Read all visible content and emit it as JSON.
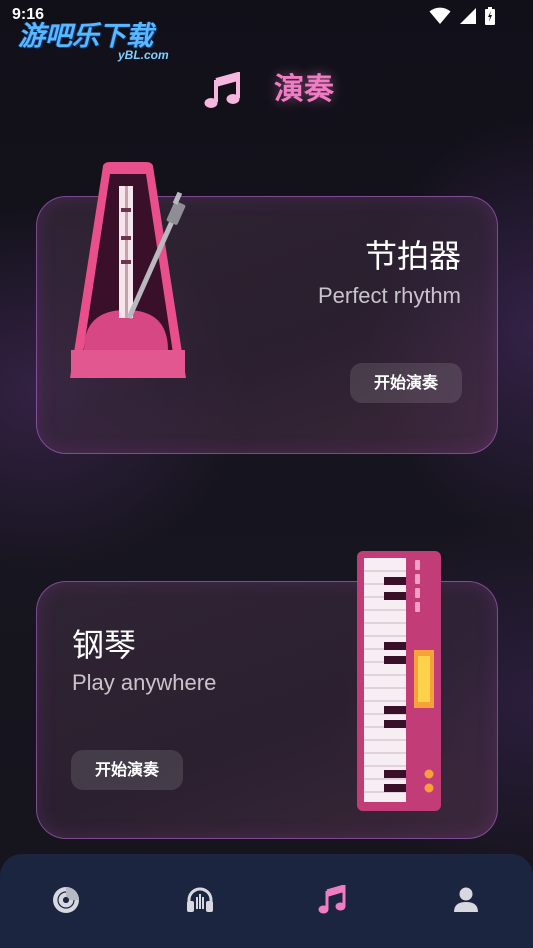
{
  "status_bar": {
    "time": "9:16"
  },
  "watermark": {
    "text": "游吧乐下载",
    "sub": "yBL.com"
  },
  "header": {
    "title": "演奏",
    "icon": "music-notes-icon"
  },
  "cards": [
    {
      "title": "节拍器",
      "subtitle": "Perfect rhythm",
      "button": "开始演奏",
      "illustration": "metronome-icon"
    },
    {
      "title": "钢琴",
      "subtitle": "Play anywhere",
      "button": "开始演奏",
      "illustration": "piano-icon"
    }
  ],
  "bottom_nav": {
    "items": [
      {
        "icon": "record-icon",
        "active": false
      },
      {
        "icon": "headphones-icon",
        "active": false
      },
      {
        "icon": "music-notes-icon",
        "active": true
      },
      {
        "icon": "person-icon",
        "active": false
      }
    ]
  },
  "colors": {
    "accent": "#f07dc3",
    "nav_background": "#1c2540",
    "nav_inactive": "#d8d8e0"
  }
}
